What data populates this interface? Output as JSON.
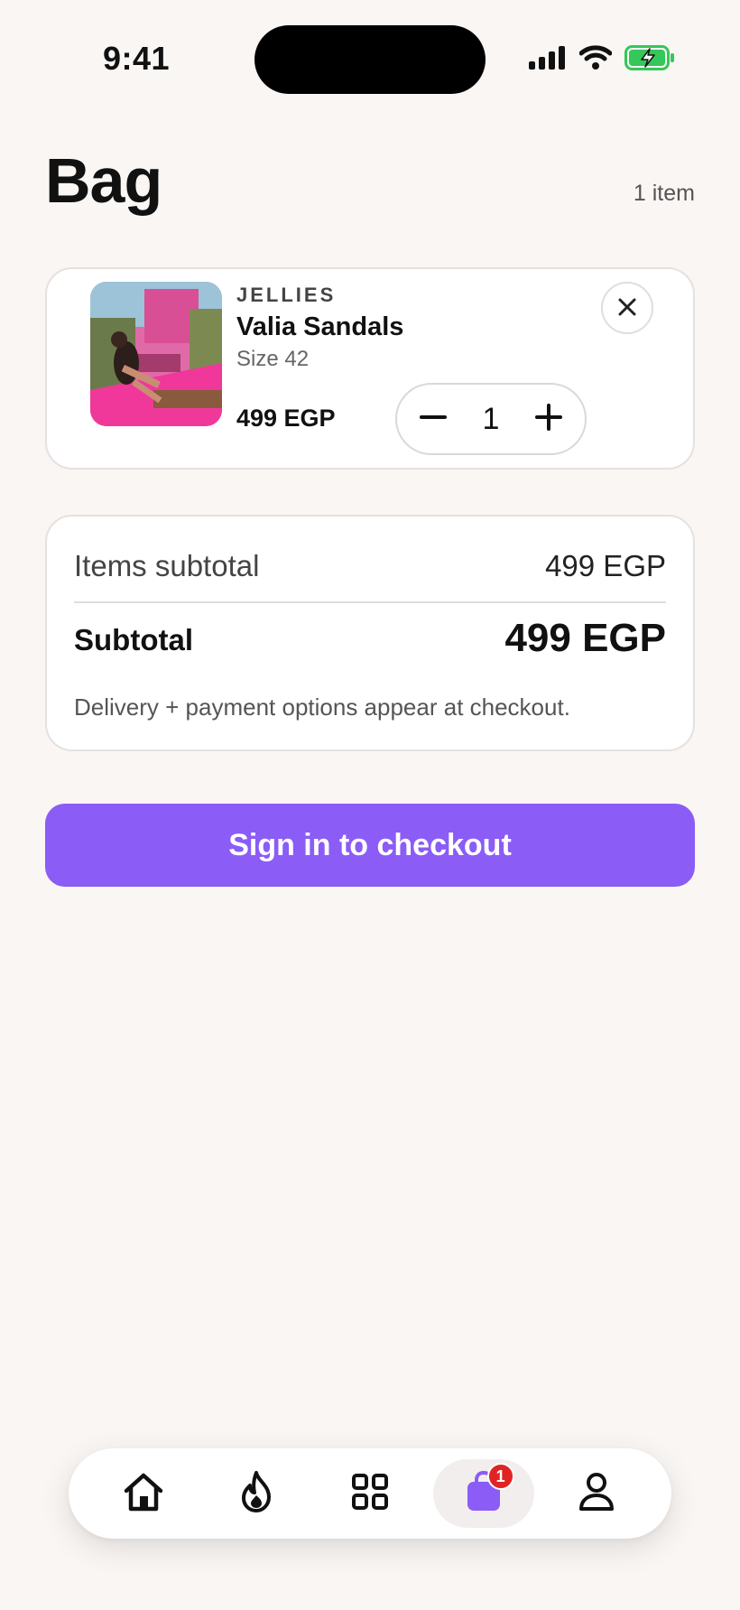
{
  "status_bar": {
    "time": "9:41"
  },
  "header": {
    "title": "Bag",
    "item_count": "1 item"
  },
  "bag_item": {
    "brand": "JELLIES",
    "name": "Valia Sandals",
    "size": "Size 42",
    "price": "499 EGP",
    "quantity": "1",
    "thumbnail_icon": "product-photo"
  },
  "summary": {
    "items_subtotal_label": "Items subtotal",
    "items_subtotal_value": "499 EGP",
    "subtotal_label": "Subtotal",
    "subtotal_value": "499 EGP",
    "note": "Delivery + payment options appear at checkout."
  },
  "checkout": {
    "label": "Sign in to checkout"
  },
  "tab_bar": {
    "items": [
      {
        "icon": "home-icon"
      },
      {
        "icon": "flame-icon"
      },
      {
        "icon": "grid-icon"
      },
      {
        "icon": "bag-icon",
        "badge": "1",
        "active": true
      },
      {
        "icon": "profile-icon"
      }
    ]
  },
  "colors": {
    "accent": "#8b5cf6",
    "badge": "#e02424",
    "background": "#faf6f4",
    "battery": "#34c759"
  }
}
